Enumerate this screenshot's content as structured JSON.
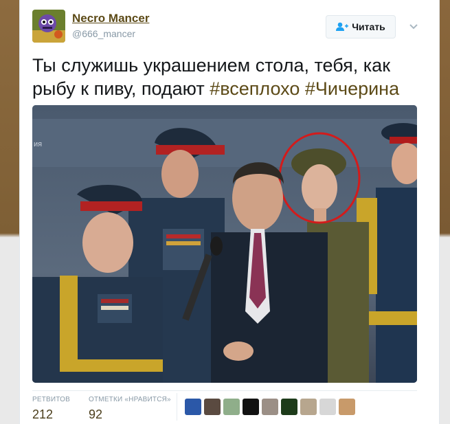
{
  "tweet": {
    "author_name": "Necro Mancer",
    "author_handle": "@666_mancer",
    "follow_label": "Читать",
    "text_plain": "Ты служишь украшением стола, тебя, как рыбу к пиву, подают ",
    "hashtag_1": "#всеплохо",
    "hashtag_2": "#Чичерина",
    "icons": {
      "follow": "add-user-icon",
      "more": "chevron-down-icon"
    }
  },
  "stats": {
    "retweets_label": "РЕТВИТОВ",
    "retweets_value": "212",
    "likes_label": "ОТМЕТКИ «НРАВИТСЯ»",
    "likes_value": "92"
  },
  "photo": {
    "overlay_text": "ия"
  },
  "colors": {
    "link": "#5c4a17",
    "highlight_circle": "#d31b1b",
    "text": "#14171a",
    "muted": "#8899a6"
  }
}
